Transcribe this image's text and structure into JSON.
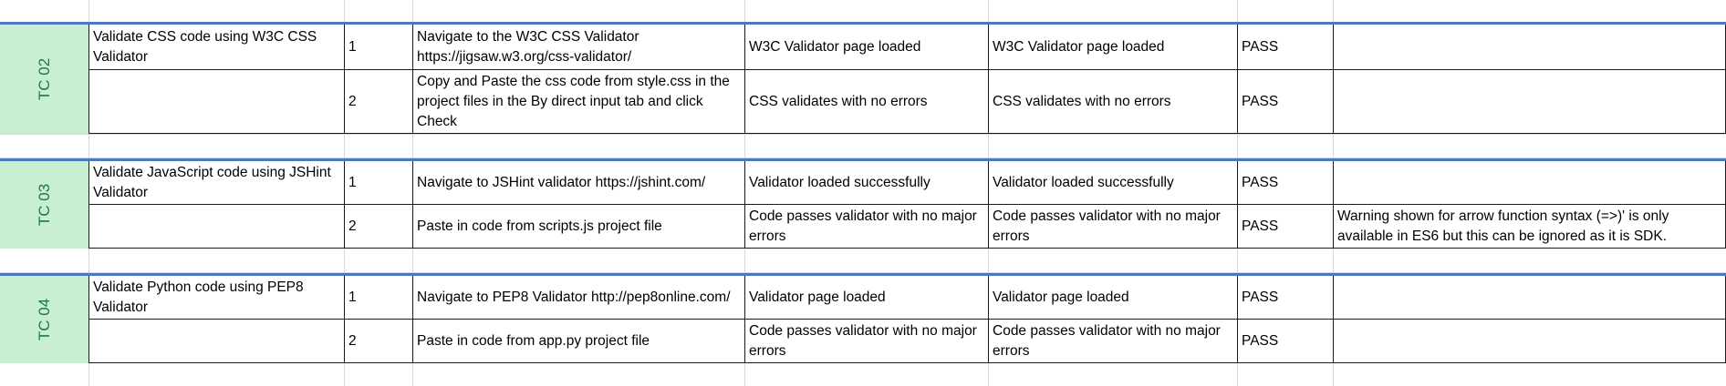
{
  "groups": [
    {
      "id": "TC 02",
      "rows": [
        {
          "desc": "Validate CSS code using W3C CSS Validator",
          "step": "1",
          "action": "Navigate to the W3C CSS Validator https://jigsaw.w3.org/css-validator/",
          "expected": "W3C Validator page loaded",
          "actual": "W3C Validator page loaded",
          "status": "PASS",
          "notes": ""
        },
        {
          "desc": "",
          "step": "2",
          "action": "Copy and Paste the css code from style.css in the project files in the By direct input tab and click Check",
          "expected": "CSS validates with no errors",
          "actual": "CSS validates with no errors",
          "status": "PASS",
          "notes": ""
        }
      ]
    },
    {
      "id": "TC 03",
      "rows": [
        {
          "desc": "Validate JavaScript code using JSHint Validator",
          "step": "1",
          "action": "Navigate to JSHint validator https://jshint.com/",
          "expected": "Validator loaded successfully",
          "actual": "Validator loaded successfully",
          "status": "PASS",
          "notes": ""
        },
        {
          "desc": "",
          "step": "2",
          "action": "Paste in code from scripts.js project file",
          "expected": "Code passes validator with no major errors",
          "actual": "Code passes validator with no major errors",
          "status": "PASS",
          "notes": "Warning shown for arrow function syntax (=>)' is only available in ES6 but this can be ignored as it is SDK."
        }
      ]
    },
    {
      "id": "TC 04",
      "rows": [
        {
          "desc": "Validate Python code using PEP8 Validator",
          "step": "1",
          "action": "Navigate to PEP8 Validator http://pep8online.com/",
          "expected": "Validator page loaded",
          "actual": "Validator page loaded",
          "status": "PASS",
          "notes": ""
        },
        {
          "desc": "",
          "step": "2",
          "action": "Paste in code from app.py project file",
          "expected": "Code passes validator with no major errors",
          "actual": "Code passes validator with no major errors",
          "status": "PASS",
          "notes": ""
        }
      ]
    }
  ]
}
